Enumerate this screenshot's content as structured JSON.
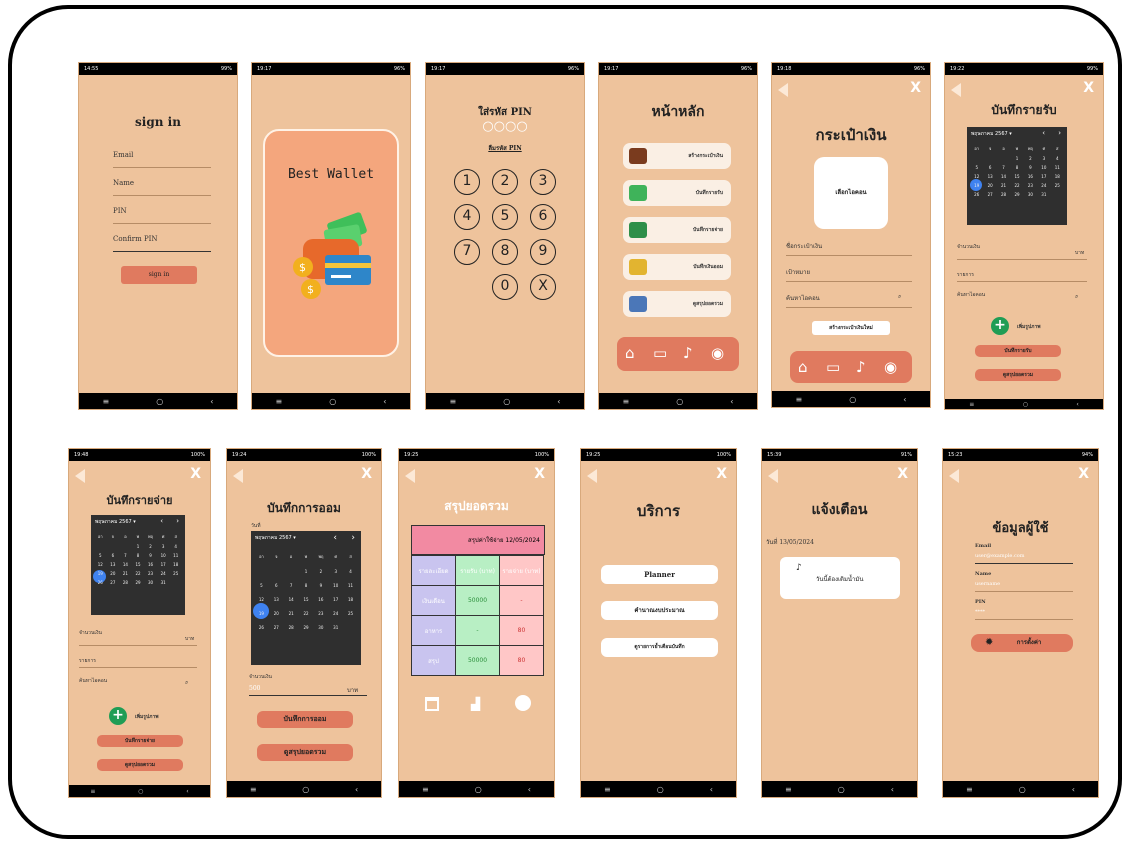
{
  "status": {
    "s1": {
      "time": "14:55",
      "right": "99%"
    },
    "s2": {
      "time": "19:17",
      "right": "96%"
    },
    "s3": {
      "time": "19:17",
      "right": "96%"
    },
    "s4": {
      "time": "19:17",
      "right": "96%"
    },
    "s5": {
      "time": "19:18",
      "right": "96%"
    },
    "s6": {
      "time": "19:22",
      "right": "99%"
    },
    "s7": {
      "time": "19:48",
      "right": "100%"
    },
    "s8": {
      "time": "19:24",
      "right": "100%"
    },
    "s9": {
      "time": "19:25",
      "right": "100%"
    },
    "s10": {
      "time": "19:25",
      "right": "100%"
    },
    "s11": {
      "time": "15:39",
      "right": "91%"
    },
    "s12": {
      "time": "15:23",
      "right": "94%"
    }
  },
  "nav": {
    "menu": "≡",
    "home": "○",
    "back": "‹"
  },
  "signin": {
    "title": "sign in",
    "email": "Email",
    "name": "Name",
    "pin": "PIN",
    "confirm": "Confirm PIN",
    "button": "sign in"
  },
  "splash": {
    "title": "Best Wallet"
  },
  "pinpad": {
    "title": "ใส่รหัส PIN",
    "dots": "○○○○",
    "forgot": "ลืมรหัส PIN",
    "keys": [
      "1",
      "2",
      "3",
      "4",
      "5",
      "6",
      "7",
      "8",
      "9",
      "0",
      "X"
    ]
  },
  "home": {
    "title": "หน้าหลัก",
    "items": [
      "สร้างกระเป๋าเงิน",
      "บันทึกรายรับ",
      "บันทึกรายจ่าย",
      "บันทึกเงินออม",
      "ดูสรุปยอดรวม"
    ]
  },
  "wallet": {
    "title": "กระเป๋าเงิน",
    "image_button": "เลือกไอคอน",
    "name_field": "ชื่อกระเป๋าเงิน",
    "target_field": "เป้าหมาย",
    "category_field": "ค้นหาไอคอน",
    "create_button": "สร้างกระเป๋าเงินใหม่"
  },
  "income": {
    "title": "บันทึกรายรับ",
    "calendar_header": "พฤษภาคม 2567 ▾",
    "amount": "จำนวนเงิน",
    "unit": "บาท",
    "item": "รายการ",
    "search": "ค้นหาไอคอน",
    "add_image": "เพิ่มรูปภาพ",
    "save": "บันทึกรายรับ",
    "summary": "ดูสรุปยอดรวม",
    "selected_day": "12"
  },
  "expense": {
    "title": "บันทึกรายจ่าย",
    "calendar_header": "พฤษภาคม 2567 ▾",
    "amount": "จำนวนเงิน",
    "unit": "บาท",
    "item": "รายการ",
    "search": "ค้นหาไอคอน",
    "add_image": "เพิ่มรูปภาพ",
    "save": "บันทึกรายจ่าย",
    "summary": "ดูสรุปยอดรวม",
    "selected_day": "12"
  },
  "saving": {
    "title": "บันทึกการออม",
    "date_label": "วันที่",
    "calendar_header": "พฤษภาคม 2567 ▾",
    "amount": "จำนวนเงิน",
    "amount_value": "500",
    "unit": "บาท",
    "save": "บันทึกการออม",
    "summary": "ดูสรุปยอดรวม",
    "selected_day": "12"
  },
  "summary": {
    "title": "สรุปยอดรวม",
    "header": "สรุปค่าใช้จ่าย 12/05/2024",
    "cols": [
      "รายละเอียด",
      "รายรับ (บาท)",
      "รายจ่าย (บาท)"
    ],
    "rows": [
      [
        "เงินเดือน",
        "50000",
        "-"
      ],
      [
        "อาหาร",
        "-",
        "80"
      ],
      [
        "สรุป",
        "50000",
        "80"
      ]
    ]
  },
  "services": {
    "title": "บริการ",
    "items": [
      "Planner",
      "คำนาณงบประมาณ",
      "ดูรายการย้ำเตือนบันทึก"
    ]
  },
  "notify": {
    "title": "แจ้งเตือน",
    "date": "วันที่ 13/05/2024",
    "message": "วันนี้ต้องเติมน้ำมัน"
  },
  "profile": {
    "title": "ข้อมูลผู้ใช้",
    "email": "Email",
    "email_value": "user@example.com",
    "name": "Name",
    "name_value": "username",
    "pin": "PIN",
    "pin_value": "****",
    "settings": "การตั้งค่า"
  },
  "calendar": {
    "weekdays": [
      "อา",
      "จ",
      "อ",
      "พ",
      "พฤ",
      "ศ",
      "ส"
    ],
    "days": [
      "",
      "",
      "",
      "1",
      "2",
      "3",
      "4",
      "5",
      "6",
      "7",
      "8",
      "9",
      "10",
      "11",
      "12",
      "13",
      "14",
      "15",
      "16",
      "17",
      "18",
      "19",
      "20",
      "21",
      "22",
      "23",
      "24",
      "25",
      "26",
      "27",
      "28",
      "29",
      "30",
      "31",
      ""
    ]
  },
  "colors": {
    "phone_bg": "#eec39c",
    "accent": "#e07a5f",
    "dark": "#2f2f2f"
  }
}
